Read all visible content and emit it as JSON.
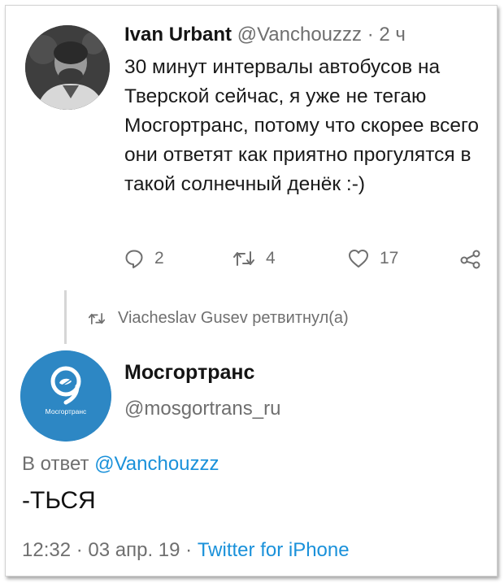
{
  "tweet": {
    "author_name": "Ivan Urbant",
    "author_handle": "@Vanchouzzz",
    "separator": "·",
    "time_ago": "2 ч",
    "text": "30 минут интервалы автобусов на Тверской сейчас, я уже не тегаю Мосгортранс, потому что скорее всего они ответят как приятно прогулятся в такой солнечный денёк :-)",
    "replies_count": "2",
    "retweets_count": "4",
    "likes_count": "17",
    "icons": {
      "reply": "reply-bubble-icon",
      "retweet": "retweet-icon",
      "like": "heart-icon",
      "share": "share-icon"
    }
  },
  "retweet_notice": {
    "icon": "retweet-icon",
    "text": "Viacheslav Gusev ретвитнул(а)"
  },
  "reply_tweet": {
    "author_name": "Мосгортранс",
    "author_handle": "@mosgortrans_ru",
    "avatar_caption": "Мосгортранс",
    "reply_prefix": "В ответ",
    "reply_to": "@Vanchouzzz",
    "text": "-ТЬСЯ",
    "time": "12:32",
    "date": "03 апр. 19",
    "separator": "·",
    "source": "Twitter for iPhone"
  },
  "colors": {
    "link": "#1a91da",
    "muted_text": "#6f6f6f",
    "brand_blue": "#2d87c4"
  }
}
